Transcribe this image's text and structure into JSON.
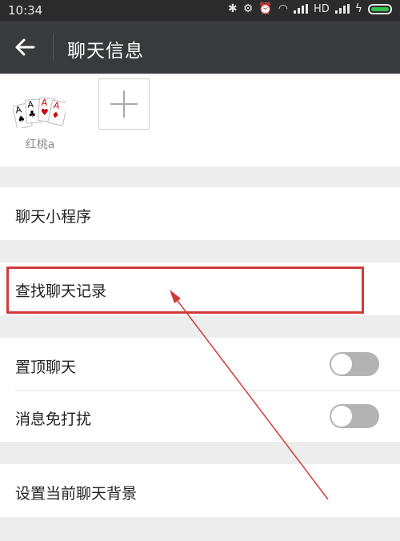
{
  "status_bar": {
    "time": "10:34",
    "network_label": "HD"
  },
  "header": {
    "title": "聊天信息"
  },
  "members": [
    {
      "name": "红桃a"
    }
  ],
  "menu": {
    "mini_program": "聊天小程序",
    "find_history": "查找聊天记录",
    "pin_chat": {
      "label": "置顶聊天",
      "on": false
    },
    "mute": {
      "label": "消息免打扰",
      "on": false
    },
    "background": "设置当前聊天背景"
  },
  "colors": {
    "header_bg": "#393a3e",
    "annotation": "#d23a3a",
    "toggle_off": "#b3b3b3",
    "battery": "#37c24e"
  }
}
